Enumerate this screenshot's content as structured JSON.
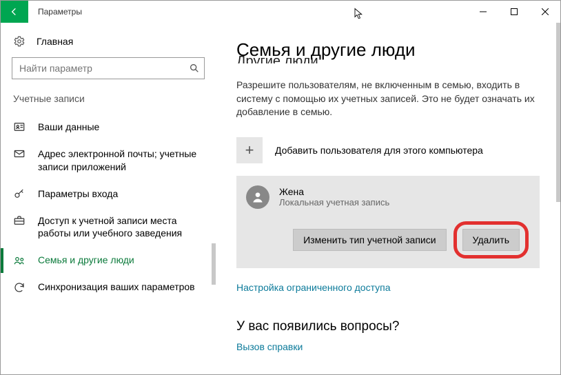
{
  "window": {
    "title": "Параметры"
  },
  "sidebar": {
    "home": "Главная",
    "searchPlaceholder": "Найти параметр",
    "section": "Учетные записи",
    "items": [
      {
        "label": "Ваши данные"
      },
      {
        "label": "Адрес электронной почты; учетные записи приложений"
      },
      {
        "label": "Параметры входа"
      },
      {
        "label": "Доступ к учетной записи места работы или учебного заведения"
      },
      {
        "label": "Семья и другие люди"
      },
      {
        "label": "Синхронизация ваших параметров"
      }
    ]
  },
  "content": {
    "pageTitle": "Семья и другие люди",
    "truncatedSubheading": "Другие люди",
    "description": "Разрешите пользователям, не включенным в семью, входить в систему с помощью их учетных записей. Это не будет означать их добавление в семью.",
    "addUser": "Добавить пользователя для этого компьютера",
    "user": {
      "name": "Жена",
      "type": "Локальная учетная запись"
    },
    "changeTypeBtn": "Изменить тип учетной записи",
    "deleteBtn": "Удалить",
    "restrictedLink": "Настройка ограниченного доступа",
    "questionHeading": "У вас появились вопросы?",
    "helpLink": "Вызов справки"
  }
}
